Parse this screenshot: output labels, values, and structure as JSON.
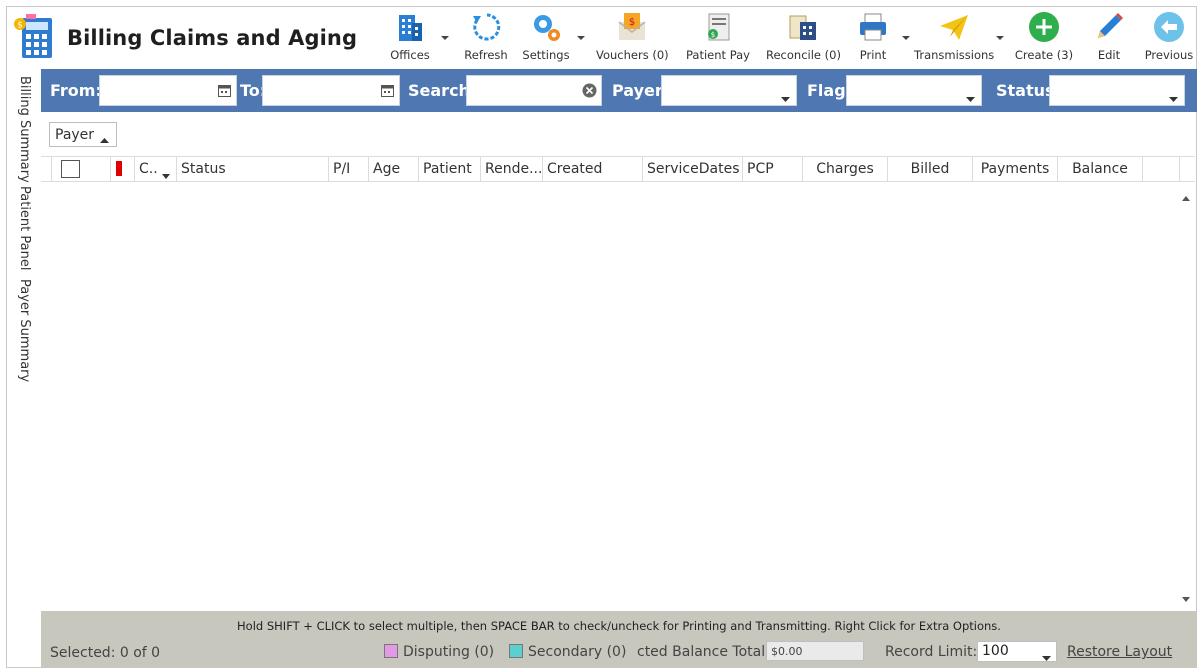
{
  "app": {
    "title": "Billing Claims and Aging"
  },
  "toolbar": {
    "offices": "Offices",
    "refresh": "Refresh",
    "settings": "Settings",
    "vouchers": "Vouchers (0)",
    "patient_pay": "Patient Pay",
    "reconcile": "Reconcile (0)",
    "print": "Print",
    "transmissions": "Transmissions",
    "create": "Create (3)",
    "edit": "Edit",
    "previous": "Previous"
  },
  "side_tabs": [
    "Billing Summary",
    "Patient Panel",
    "Payer Summary"
  ],
  "filters": {
    "from_label": "From:",
    "from_value": "",
    "to_label": "To:",
    "to_value": "",
    "search_label": "Search:",
    "search_value": "",
    "payer_label": "Payer:",
    "payer_value": "",
    "flag_label": "Flag:",
    "flag_value": "",
    "status_label": "Status:",
    "status_value": ""
  },
  "group_by": {
    "label": "Payer"
  },
  "columns": [
    "C..",
    "Status",
    "P/I",
    "Age",
    "Patient",
    "Rende...",
    "Created",
    "ServiceDates",
    "PCP",
    "Charges",
    "Billed",
    "Payments",
    "Balance"
  ],
  "rows": [],
  "footer": {
    "hint": "Hold SHIFT + CLICK to select multiple, then SPACE BAR to check/uncheck for Printing and Transmitting. Right Click for Extra Options.",
    "selected": "Selected: 0 of 0",
    "disputing": "Disputing (0)",
    "secondary": "Secondary (0)",
    "balance_label": "cted Balance Total:",
    "balance_value": "$0.00",
    "record_limit_label": "Record Limit:",
    "record_limit_value": "100",
    "restore_layout": "Restore Layout"
  },
  "colors": {
    "filter_bar": "#4f78b3",
    "footer": "#c8c7bd",
    "disputing": "#e39ae6",
    "secondary": "#5ccfcf",
    "flag": "#e00000"
  }
}
